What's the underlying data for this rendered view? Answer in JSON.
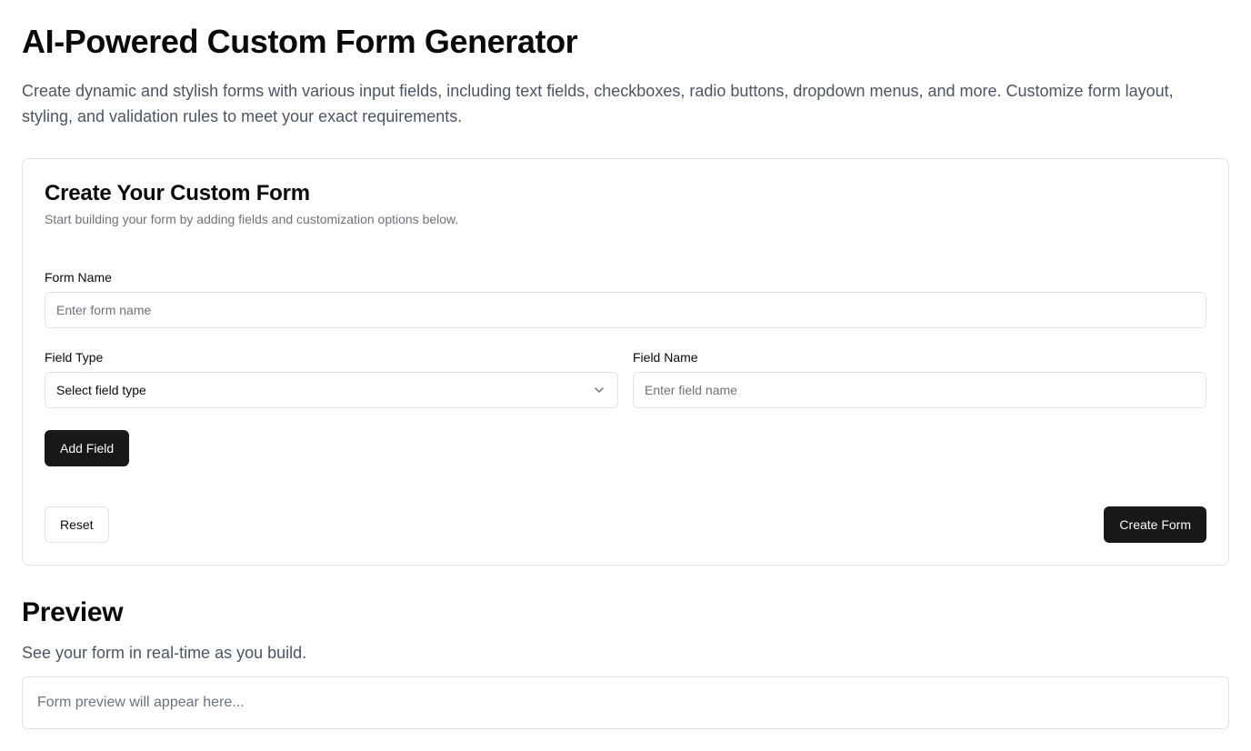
{
  "header": {
    "title": "AI-Powered Custom Form Generator",
    "description": "Create dynamic and stylish forms with various input fields, including text fields, checkboxes, radio buttons, dropdown menus, and more. Customize form layout, styling, and validation rules to meet your exact requirements."
  },
  "builder": {
    "title": "Create Your Custom Form",
    "subtitle": "Start building your form by adding fields and customization options below.",
    "form_name": {
      "label": "Form Name",
      "placeholder": "Enter form name",
      "value": ""
    },
    "field_type": {
      "label": "Field Type",
      "selected": "Select field type",
      "icon": "chevron-down-icon"
    },
    "field_name": {
      "label": "Field Name",
      "placeholder": "Enter field name",
      "value": ""
    },
    "add_field_label": "Add Field",
    "reset_label": "Reset",
    "create_label": "Create Form"
  },
  "preview": {
    "title": "Preview",
    "description": "See your form in real-time as you build.",
    "placeholder": "Form preview will appear here..."
  },
  "colors": {
    "primary_button": "#18181b",
    "border": "#e4e4e7",
    "muted_text": "#71717a"
  }
}
